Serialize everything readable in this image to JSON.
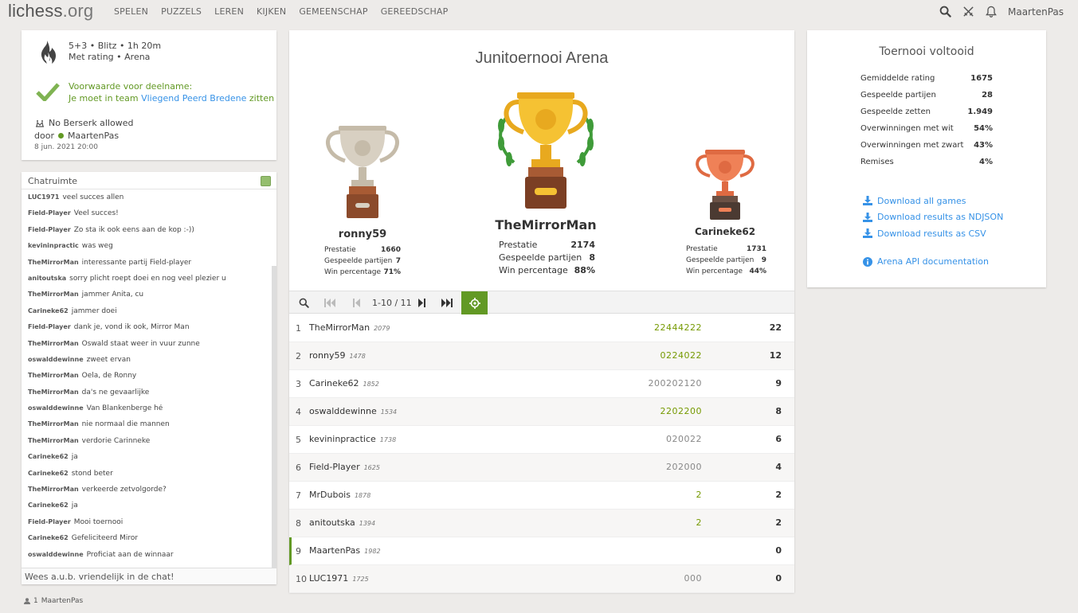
{
  "header": {
    "logo_main": "lichess",
    "logo_tld": ".org",
    "nav": [
      "SPELEN",
      "PUZZELS",
      "LEREN",
      "KIJKEN",
      "GEMEENSCHAP",
      "GEREEDSCHAP"
    ],
    "username": "MaartenPas",
    "icons": [
      "search-icon",
      "swords-icon",
      "bell-icon"
    ]
  },
  "info": {
    "line1": "5+3 • Blitz • 1h 20m",
    "line2": "Met rating • Arena",
    "condition_label": "Voorwaarde voor deelname:",
    "condition_pre": "Je moet in team ",
    "condition_team": "Vliegend Peerd Bredene",
    "condition_post": " zitten",
    "berserk": "No Berserk allowed",
    "by_label": "door",
    "by_user": "MaartenPas",
    "date": "8 jun. 2021 20:00"
  },
  "chat": {
    "title": "Chatruimte",
    "lines": [
      {
        "user": "LUC1971",
        "text": "veel succes allen"
      },
      {
        "user": "Field-Player",
        "text": "Veel succes!"
      },
      {
        "user": "Field-Player",
        "text": "Zo sta ik ook eens aan de kop :-))"
      },
      {
        "user": "kevininpractic",
        "text": "was weg"
      },
      {
        "user": "TheMirrorMan",
        "text": "interessante partij Field-player"
      },
      {
        "user": "anitoutska",
        "text": "sorry plicht roept doei en nog veel plezier u"
      },
      {
        "user": "TheMirrorMan",
        "text": "jammer Anita, cu"
      },
      {
        "user": "Carineke62",
        "text": "jammer doei"
      },
      {
        "user": "Field-Player",
        "text": "dank je, vond ik ook, Mirror Man"
      },
      {
        "user": "TheMirrorMan",
        "text": "Oswald staat weer in vuur zunne"
      },
      {
        "user": "oswalddewinne",
        "text": "zweet ervan"
      },
      {
        "user": "TheMirrorMan",
        "text": "Oela, de Ronny"
      },
      {
        "user": "TheMirrorMan",
        "text": "da's ne gevaarlijke"
      },
      {
        "user": "oswalddewinne",
        "text": "Van Blankenberge hé"
      },
      {
        "user": "TheMirrorMan",
        "text": "nie normaal die mannen"
      },
      {
        "user": "TheMirrorMan",
        "text": "verdorie Carinneke"
      },
      {
        "user": "Carineke62",
        "text": "ja"
      },
      {
        "user": "Carineke62",
        "text": "stond beter"
      },
      {
        "user": "TheMirrorMan",
        "text": "verkeerde zetvolgorde?"
      },
      {
        "user": "Carineke62",
        "text": "ja"
      },
      {
        "user": "Field-Player",
        "text": "Mooi toernooi"
      },
      {
        "user": "Carineke62",
        "text": "Gefeliciteerd Miror"
      },
      {
        "user": "oswalddewinne",
        "text": "Proficiat aan de winnaar"
      }
    ],
    "input_placeholder": "Wees a.u.b. vriendelijk in de chat!",
    "watchers_count": "1",
    "watchers_user": "MaartenPas"
  },
  "tournament": {
    "title": "Junitoernooi Arena",
    "podium": {
      "first": {
        "name": "TheMirrorMan",
        "perf_label": "Prestatie",
        "perf": "2174",
        "games_label": "Gespeelde partijen",
        "games": "8",
        "win_label": "Win percentage",
        "win": "88%"
      },
      "second": {
        "name": "ronny59",
        "perf_label": "Prestatie",
        "perf": "1660",
        "games_label": "Gespeelde partijen",
        "games": "7",
        "win_label": "Win percentage",
        "win": "71%"
      },
      "third": {
        "name": "Carineke62",
        "perf_label": "Prestatie",
        "perf": "1731",
        "games_label": "Gespeelde partijen",
        "games": "9",
        "win_label": "Win percentage",
        "win": "44%"
      }
    },
    "pager": "1-10 / 11",
    "standings": [
      {
        "rank": "1",
        "name": "TheMirrorMan",
        "rating": "2079",
        "sheet": "22444222",
        "win": true,
        "total": "22"
      },
      {
        "rank": "2",
        "name": "ronny59",
        "rating": "1478",
        "sheet": "0224022",
        "win": true,
        "total": "12"
      },
      {
        "rank": "3",
        "name": "Carineke62",
        "rating": "1852",
        "sheet": "200202120",
        "win": false,
        "total": "9"
      },
      {
        "rank": "4",
        "name": "oswalddewinne",
        "rating": "1534",
        "sheet": "2202200",
        "win": true,
        "total": "8"
      },
      {
        "rank": "5",
        "name": "kevininpractice",
        "rating": "1738",
        "sheet": "020022",
        "win": false,
        "total": "6"
      },
      {
        "rank": "6",
        "name": "Field-Player",
        "rating": "1625",
        "sheet": "202000",
        "win": false,
        "total": "4"
      },
      {
        "rank": "7",
        "name": "MrDubois",
        "rating": "1878",
        "sheet": "2",
        "win": true,
        "total": "2"
      },
      {
        "rank": "8",
        "name": "anitoutska",
        "rating": "1394",
        "sheet": "2",
        "win": true,
        "total": "2"
      },
      {
        "rank": "9",
        "name": "MaartenPas",
        "rating": "1982",
        "sheet": "",
        "win": false,
        "total": "0",
        "me": true
      },
      {
        "rank": "10",
        "name": "LUC1971",
        "rating": "1725",
        "sheet": "000",
        "win": false,
        "total": "0"
      }
    ]
  },
  "summary": {
    "title": "Toernooi voltooid",
    "stats": [
      {
        "label": "Gemiddelde rating",
        "value": "1675"
      },
      {
        "label": "Gespeelde partijen",
        "value": "28"
      },
      {
        "label": "Gespeelde zetten",
        "value": "1.949"
      },
      {
        "label": "Overwinningen met wit",
        "value": "54%"
      },
      {
        "label": "Overwinningen met zwart",
        "value": "43%"
      },
      {
        "label": "Remises",
        "value": "4%"
      }
    ],
    "downloads": [
      "Download all games",
      "Download results as NDJSON",
      "Download results as CSV"
    ],
    "api": "Arena API documentation",
    "colors": {
      "accent": "#629924",
      "link": "#3692e7",
      "gold": "#f5c233",
      "silver": "#cfc6b6",
      "bronze": "#ef8157"
    }
  }
}
